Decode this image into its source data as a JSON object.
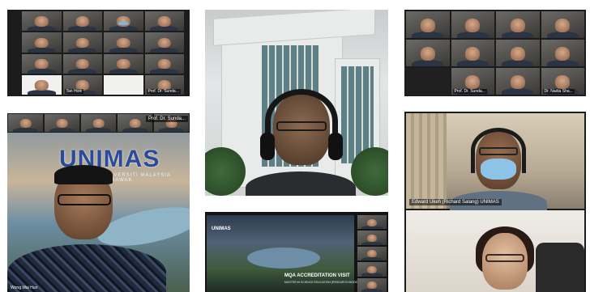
{
  "collage": {
    "shot1": {
      "labels": [
        "",
        "",
        "",
        "",
        "",
        "",
        "",
        "",
        "",
        "",
        "",
        "",
        "",
        "Tan Hiok",
        "",
        "Prof. Dr. Sunda..."
      ]
    },
    "shot3": {
      "labels": [
        "",
        "",
        "",
        "",
        "",
        "",
        "",
        "",
        "",
        "Prof. Dr. Sunda...",
        "",
        "Dr. Nadia Sha..."
      ]
    },
    "shot4": {
      "logo": "UNIMAS",
      "logo_sub": "UNIVERSITI MALAYSIA SARAWAK",
      "name_bar": "Prof. Dr. Sunda...",
      "caption": "Wong Wai Hun"
    },
    "shot5": {
      "slide_logo": "UNIMAS",
      "title": "MQA ACCREDITATION VISIT",
      "subtitle": "MASTER IN SCIENCE EDUCATION (RESEARCH MODE)"
    },
    "shot6": {
      "name_label": "Edward Ukeh (Richard Salang) UNIMAS"
    }
  }
}
